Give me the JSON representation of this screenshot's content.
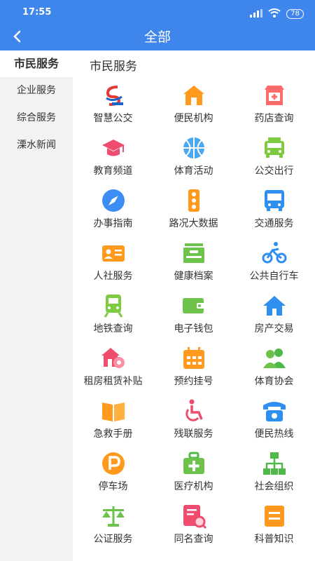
{
  "status": {
    "time": "17:55",
    "battery": "78"
  },
  "header": {
    "title": "全部"
  },
  "sidebar": {
    "items": [
      {
        "label": "市民服务",
        "active": true
      },
      {
        "label": "企业服务"
      },
      {
        "label": "综合服务"
      },
      {
        "label": "溧水新闻"
      }
    ]
  },
  "main": {
    "section_title": "市民服务",
    "services": [
      {
        "label": "智慧公交",
        "icon": "smart-bus-logo-icon"
      },
      {
        "label": "便民机构",
        "icon": "home-icon"
      },
      {
        "label": "药店查询",
        "icon": "pharmacy-icon"
      },
      {
        "label": "教育频道",
        "icon": "graduation-cap-icon"
      },
      {
        "label": "体育活动",
        "icon": "basketball-icon"
      },
      {
        "label": "公交出行",
        "icon": "bus-front-icon"
      },
      {
        "label": "办事指南",
        "icon": "compass-icon"
      },
      {
        "label": "路况大数据",
        "icon": "traffic-light-icon"
      },
      {
        "label": "交通服务",
        "icon": "bus-icon"
      },
      {
        "label": "人社服务",
        "icon": "id-card-icon"
      },
      {
        "label": "健康档案",
        "icon": "archive-box-icon"
      },
      {
        "label": "公共自行车",
        "icon": "bicycle-icon"
      },
      {
        "label": "地铁查询",
        "icon": "metro-train-icon"
      },
      {
        "label": "电子钱包",
        "icon": "wallet-icon"
      },
      {
        "label": "房产交易",
        "icon": "house-icon"
      },
      {
        "label": "租房租赁补贴",
        "icon": "rent-house-key-icon"
      },
      {
        "label": "预约挂号",
        "icon": "calendar-icon"
      },
      {
        "label": "体育协会",
        "icon": "people-group-icon"
      },
      {
        "label": "急救手册",
        "icon": "book-icon"
      },
      {
        "label": "残联服务",
        "icon": "wheelchair-icon"
      },
      {
        "label": "便民热线",
        "icon": "phone-icon"
      },
      {
        "label": "停车场",
        "icon": "parking-icon"
      },
      {
        "label": "医疗机构",
        "icon": "medical-kit-icon"
      },
      {
        "label": "社会组织",
        "icon": "org-chart-icon"
      },
      {
        "label": "公证服务",
        "icon": "scale-balance-icon"
      },
      {
        "label": "同名查询",
        "icon": "search-document-icon"
      },
      {
        "label": "科普知识",
        "icon": "note-list-icon"
      }
    ]
  },
  "colors": {
    "header": "#3f86ec",
    "sidebar": "#f2f2f2"
  }
}
